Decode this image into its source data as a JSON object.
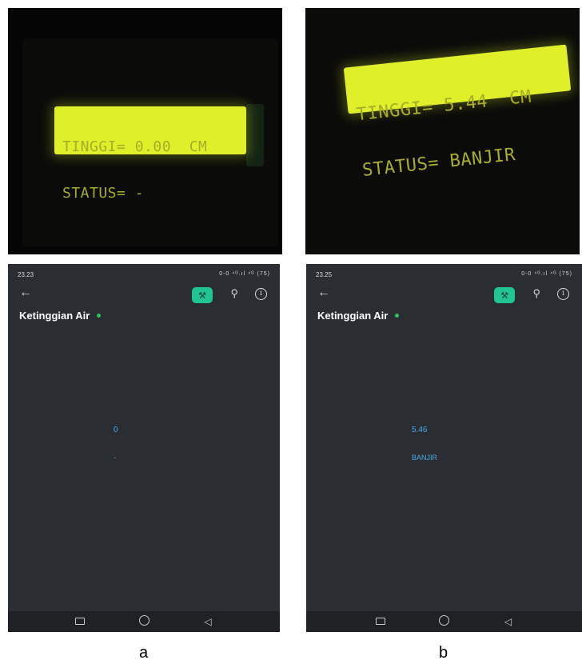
{
  "panels": {
    "a": {
      "lcd": {
        "line1": "TINGGI= 0.00  CM",
        "line2": "STATUS= -"
      },
      "phone": {
        "time": "23.23",
        "status_icons": "0-0 ⁴ᴳ.ıl ⁴ᴳ (75)",
        "title": "Ketinggian Air",
        "value": "0",
        "status": "-"
      },
      "caption": "a"
    },
    "b": {
      "lcd": {
        "line1": "TINGGI= 5.44  CM",
        "line2": "STATUS= BANJIR"
      },
      "phone": {
        "time": "23.25",
        "status_icons": "0-0 ⁴ᴳ.ıl ⁴ᴳ (75)",
        "title": "Ketinggian Air",
        "value": "5.46",
        "status": "BANJIR"
      },
      "caption": "b"
    }
  },
  "icons": {
    "back": "←",
    "wrench": "🔧",
    "bell": "🔔",
    "info": "i",
    "nav_back": "◁"
  },
  "colors": {
    "accent": "#21c493",
    "widget_text": "#4aa8e8",
    "online": "#2fc45a",
    "lcd": "#dff02a",
    "app_bg": "#2a2d31"
  }
}
